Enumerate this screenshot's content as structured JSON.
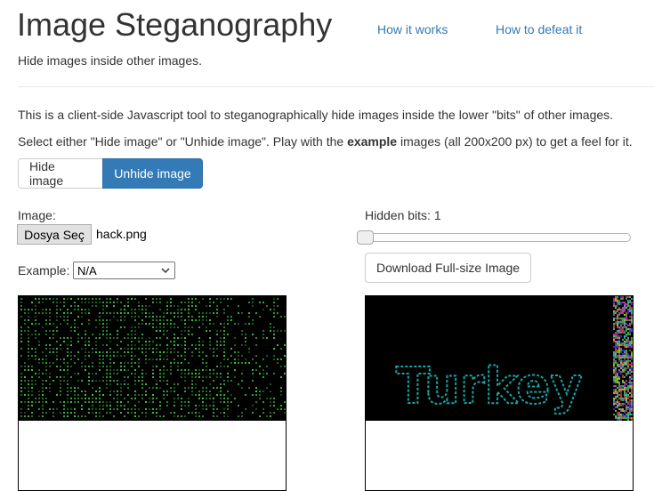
{
  "header": {
    "title": "Image Steganography",
    "nav": [
      {
        "label": "How it works"
      },
      {
        "label": "How to defeat it"
      }
    ],
    "subtitle": "Hide images inside other images."
  },
  "intro": {
    "line1": "This is a client-side Javascript tool to steganographically hide images inside the lower \"bits\" of other images.",
    "line2_prefix": "Select either \"Hide image\" or \"Unhide image\". Play with the ",
    "line2_bold": "example",
    "line2_suffix": " images (all 200x200 px) to get a feel for it."
  },
  "mode_toggle": {
    "hide_label": "Hide image",
    "unhide_label": "Unhide image",
    "active": "Unhide image"
  },
  "left_panel": {
    "image_label": "Image:",
    "file_button_label": "Dosya Seç",
    "file_name": "hack.png",
    "example_label": "Example:",
    "example_selected": "N/A"
  },
  "right_panel": {
    "hidden_bits_label": "Hidden bits: 1",
    "hidden_bits_value": 1,
    "download_label": "Download Full-size Image"
  },
  "canvases": {
    "left_content": "green matrix code pattern",
    "right_overlay_text": "Turkey",
    "right_overlay_color": "#1aa3a3"
  },
  "colors": {
    "accent": "#337ab7",
    "link": "#337ab7",
    "matrix_green": "#3ec23e",
    "canvas_bg": "#000000"
  }
}
